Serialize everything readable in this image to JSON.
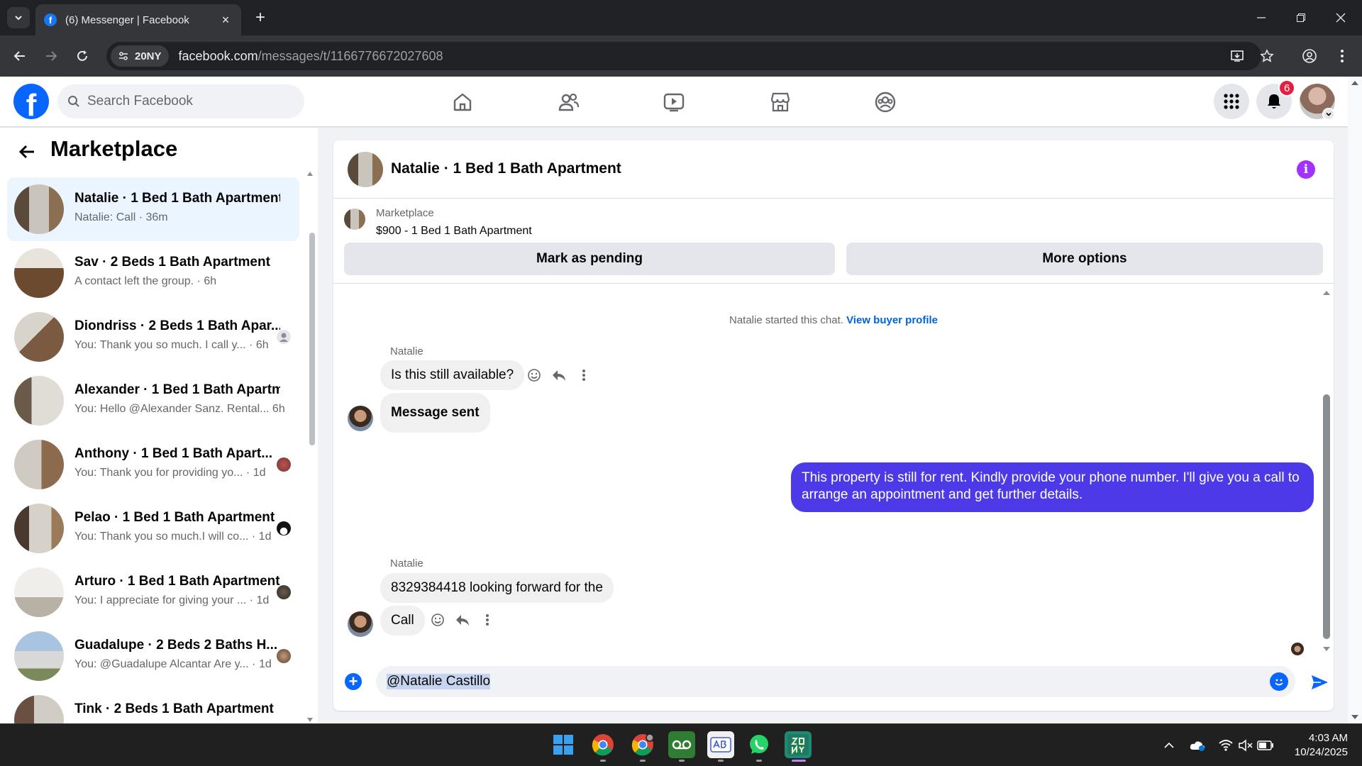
{
  "browser": {
    "tab_title": "(6) Messenger | Facebook",
    "site_chip": "20NY",
    "url_host": "facebook.com",
    "url_path": "/messages/t/1166776672027608"
  },
  "fb": {
    "search_placeholder": "Search Facebook",
    "notification_count": "6"
  },
  "sidebar": {
    "title": "Marketplace",
    "conversations": [
      {
        "name": "Natalie · 1 Bed 1 Bath Apartment",
        "snippet": "Natalie: Call · 36m",
        "active": true
      },
      {
        "name": "Sav · 2 Beds 1 Bath Apartment",
        "snippet": "A contact left the group. · 6h"
      },
      {
        "name": "Diondriss · 2 Beds 1 Bath Apar...",
        "snippet": "You: Thank you so much. I call y... · 6h"
      },
      {
        "name": "Alexander · 1 Bed 1 Bath Apartm...",
        "snippet": "You: Hello @Alexander Sanz. Rental... 6h"
      },
      {
        "name": "Anthony · 1 Bed 1 Bath Apart...",
        "snippet": "You: Thank you for providing yo... · 1d"
      },
      {
        "name": "Pelao · 1 Bed 1 Bath Apartment",
        "snippet": "You: Thank you so much.I will co... · 1d"
      },
      {
        "name": "Arturo · 1 Bed 1 Bath Apartment",
        "snippet": "You: I appreciate for giving your ... · 1d"
      },
      {
        "name": "Guadalupe · 2 Beds 2 Baths H...",
        "snippet": "You: @Guadalupe Alcantar Are y... · 1d"
      },
      {
        "name": "Tink · 2 Beds 1 Bath Apartment",
        "snippet": ""
      }
    ]
  },
  "chat": {
    "title": "Natalie · 1 Bed 1 Bath Apartment",
    "marketplace_label": "Marketplace",
    "listing": "$900 - 1 Bed 1 Bath Apartment",
    "mark_pending": "Mark as pending",
    "more_options": "More options",
    "started_text": "Natalie started this chat.",
    "view_profile": "View buyer profile",
    "messages": {
      "sender1": "Natalie",
      "m1": "Is this still available?",
      "m2": "Message sent",
      "out1": "This property is still for rent.  Kindly provide your phone number.  I'll give you a call to arrange an appointment and get further details.",
      "sender2": "Natalie",
      "m3": "8329384418 looking forward for the",
      "m4": "Call"
    },
    "composer_text": "@Natalie Castillo"
  },
  "taskbar": {
    "time": "4:03 AM",
    "date": "10/24/2025"
  }
}
